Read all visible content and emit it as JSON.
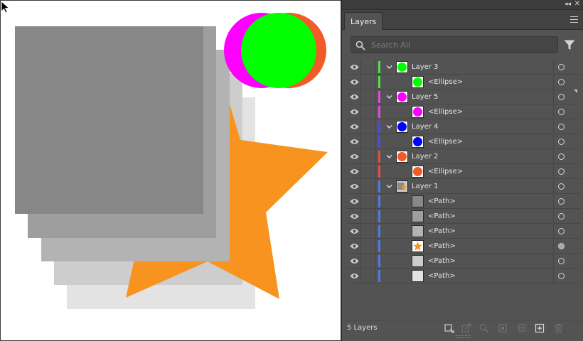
{
  "panel": {
    "tab_label": "Layers",
    "search_placeholder": "Search All",
    "footer_count": "5 Layers"
  },
  "colors": {
    "panel_bg": "#535353",
    "star": "#f7931e",
    "magenta": "#ff00ff",
    "green": "#00ff00",
    "orange_red": "#f15a29",
    "blue": "#0000ff",
    "layer3_bar": "#55e04a",
    "layer5_bar": "#d94fd9",
    "layer4_bar": "#4d4dd9",
    "layer2_bar": "#e0524a",
    "layer1_bar": "#4f7ae0"
  },
  "layers": [
    {
      "label": "Layer 3",
      "kind": "layer",
      "thumb": "green-dot",
      "target": "empty"
    },
    {
      "label": "<Ellipse>",
      "kind": "sublayer",
      "thumb": "green-dot",
      "target": "empty"
    },
    {
      "label": "Layer 5",
      "kind": "layer",
      "thumb": "magenta-dot",
      "target": "empty"
    },
    {
      "label": "<Ellipse>",
      "kind": "sublayer",
      "thumb": "magenta-dot",
      "target": "empty"
    },
    {
      "label": "Layer 4",
      "kind": "layer",
      "thumb": "blue-dot",
      "target": "empty"
    },
    {
      "label": "<Ellipse>",
      "kind": "sublayer",
      "thumb": "blue-dot",
      "target": "empty"
    },
    {
      "label": "Layer 2",
      "kind": "layer",
      "thumb": "orange-dot",
      "target": "empty"
    },
    {
      "label": "<Ellipse>",
      "kind": "sublayer",
      "thumb": "orange-dot",
      "target": "empty"
    },
    {
      "label": "Layer 1",
      "kind": "layer",
      "thumb": "mixed",
      "target": "empty"
    },
    {
      "label": "<Path>",
      "kind": "sublayer",
      "thumb": "gray-1",
      "target": "empty"
    },
    {
      "label": "<Path>",
      "kind": "sublayer",
      "thumb": "gray-2",
      "target": "empty"
    },
    {
      "label": "<Path>",
      "kind": "sublayer",
      "thumb": "gray-3",
      "target": "empty"
    },
    {
      "label": "<Path>",
      "kind": "sublayer",
      "thumb": "star",
      "target": "filled"
    },
    {
      "label": "<Path>",
      "kind": "sublayer",
      "thumb": "gray-4",
      "target": "empty"
    },
    {
      "label": "<Path>",
      "kind": "sublayer",
      "thumb": "gray-5",
      "target": "empty"
    }
  ],
  "footer_icons": [
    "collect-for-export-icon",
    "export-icon",
    "locate-object-icon",
    "make-clipping-mask-icon",
    "new-sublayer-icon",
    "new-layer-icon",
    "delete-layer-icon"
  ]
}
